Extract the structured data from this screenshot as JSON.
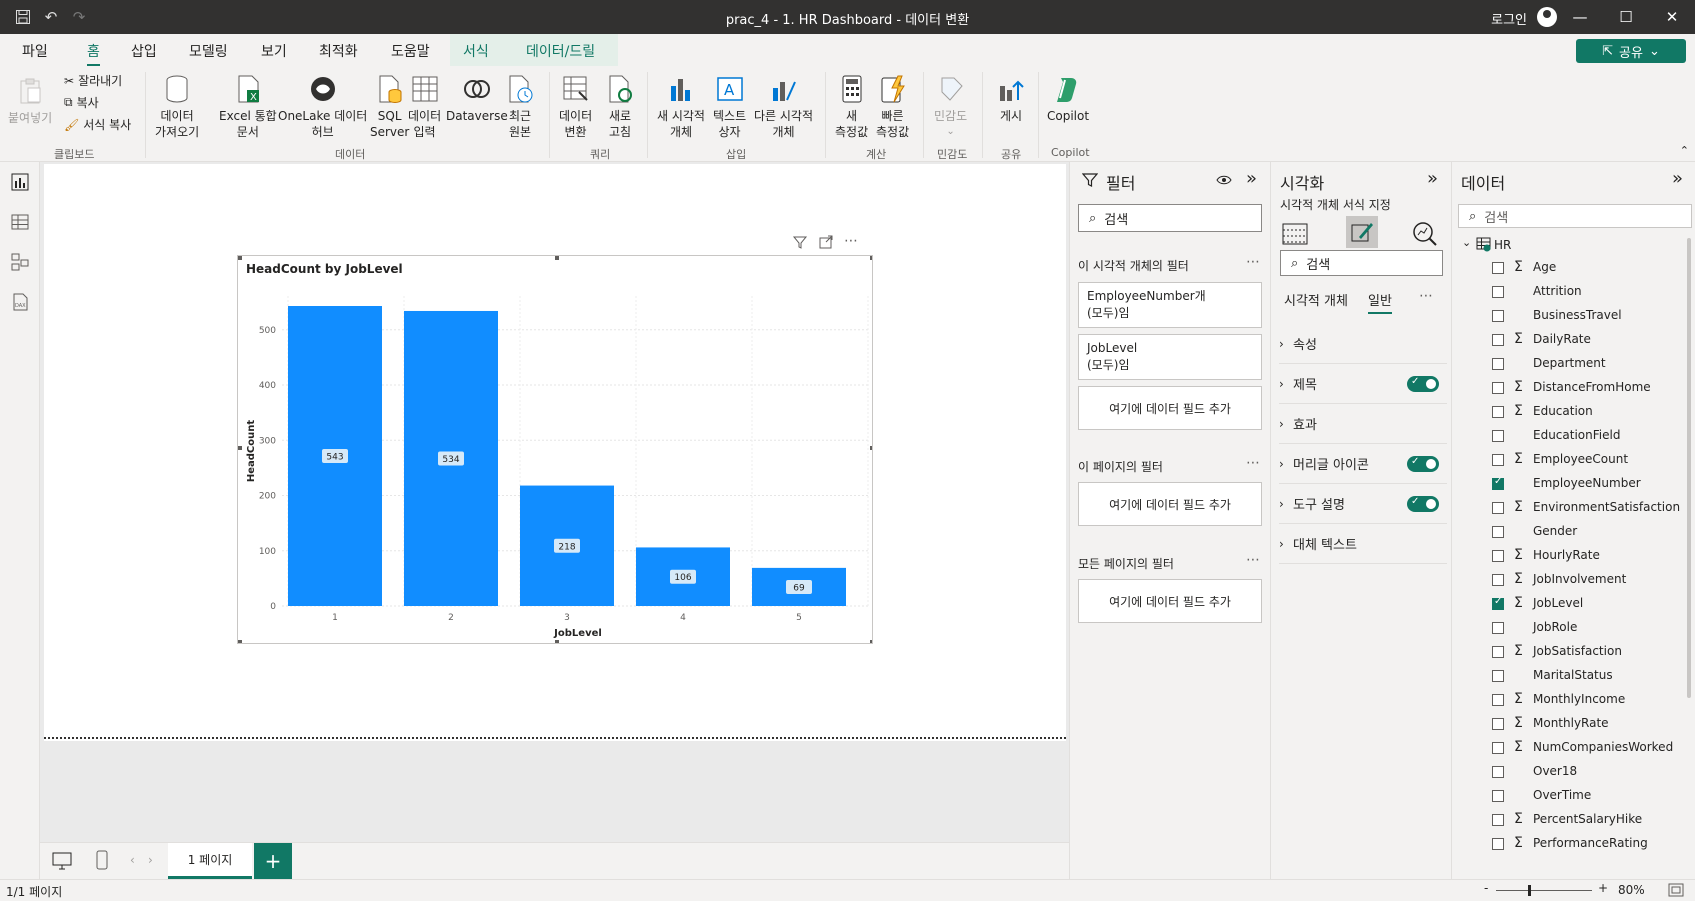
{
  "titlebar": {
    "title": "prac_4 - 1. HR Dashboard - 데이터 변환",
    "login": "로그인"
  },
  "menu": {
    "tabs": [
      "파일",
      "홈",
      "삽입",
      "모델링",
      "보기",
      "최적화",
      "도움말",
      "서식",
      "데이터/드릴"
    ],
    "active": "홈",
    "share": "공유"
  },
  "ribbon": {
    "paste": "붙여넣기",
    "cut": "잘라내기",
    "copy": "복사",
    "format_copy": "서식 복사",
    "clipboard": "클립보드",
    "get_data_1": "데이터",
    "get_data_2": "가져오기",
    "excel_1": "Excel 통합",
    "excel_2": "문서",
    "onelake_1": "OneLake 데이터",
    "onelake_2": "허브",
    "sql_1": "SQL",
    "sql_2": "Server",
    "enter_1": "데이터",
    "enter_2": "입력",
    "dataverse": "Dataverse",
    "recent_1": "최근",
    "recent_2": "원본",
    "data_group": "데이터",
    "transform_1": "데이터",
    "transform_2": "변환",
    "refresh_1": "새로",
    "refresh_2": "고침",
    "query_group": "쿼리",
    "newvisual_1": "새 시각적",
    "newvisual_2": "개체",
    "textbox_1": "텍스트",
    "textbox_2": "상자",
    "othervisual_1": "다른 시각적",
    "othervisual_2": "개체",
    "insert_group": "삽입",
    "newmeasure_1": "새",
    "newmeasure_2": "측정값",
    "quickmeasure_1": "빠른",
    "quickmeasure_2": "측정값",
    "calc_group": "계산",
    "sensitivity": "민감도",
    "sens_group": "민감도",
    "publish": "게시",
    "share_group": "공유",
    "copilot": "Copilot",
    "copilot_group": "Copilot"
  },
  "chart_data": {
    "type": "bar",
    "title": "HeadCount by JobLevel",
    "xlabel": "JobLevel",
    "ylabel": "HeadCount",
    "categories": [
      "1",
      "2",
      "3",
      "4",
      "5"
    ],
    "values": [
      543,
      534,
      218,
      106,
      69
    ],
    "yticks": [
      "0",
      "100",
      "200",
      "300",
      "400",
      "500"
    ],
    "ylim": [
      0,
      543
    ],
    "grid": true,
    "bar_color": "#118DFF"
  },
  "filters": {
    "title": "필터",
    "search": "검색",
    "visual_section": "이 시각적 개체의 필터",
    "card1_line1": "EmployeeNumber개",
    "card1_line2": "(모두)임",
    "card2_line1": "JobLevel",
    "card2_line2": "(모두)임",
    "add_field": "여기에 데이터 필드 추가",
    "page_section": "이 페이지의 필터",
    "all_section": "모든 페이지의 필터"
  },
  "viz": {
    "title": "시각화",
    "subtitle": "시각적 개체 서식 지정",
    "search": "검색",
    "tab_visual": "시각적 개체",
    "tab_general": "일반",
    "rows": [
      "속성",
      "제목",
      "효과",
      "머리글 아이콘",
      "도구 설명",
      "대체 텍스트"
    ]
  },
  "data": {
    "title": "데이터",
    "search": "검색",
    "table": "HR",
    "fields": [
      {
        "name": "Age",
        "sigma": true,
        "checked": false
      },
      {
        "name": "Attrition",
        "sigma": false,
        "checked": false
      },
      {
        "name": "BusinessTravel",
        "sigma": false,
        "checked": false
      },
      {
        "name": "DailyRate",
        "sigma": true,
        "checked": false
      },
      {
        "name": "Department",
        "sigma": false,
        "checked": false
      },
      {
        "name": "DistanceFromHome",
        "sigma": true,
        "checked": false
      },
      {
        "name": "Education",
        "sigma": true,
        "checked": false
      },
      {
        "name": "EducationField",
        "sigma": false,
        "checked": false
      },
      {
        "name": "EmployeeCount",
        "sigma": true,
        "checked": false
      },
      {
        "name": "EmployeeNumber",
        "sigma": false,
        "checked": true
      },
      {
        "name": "EnvironmentSatisfaction",
        "sigma": true,
        "checked": false
      },
      {
        "name": "Gender",
        "sigma": false,
        "checked": false
      },
      {
        "name": "HourlyRate",
        "sigma": true,
        "checked": false
      },
      {
        "name": "JobInvolvement",
        "sigma": true,
        "checked": false
      },
      {
        "name": "JobLevel",
        "sigma": true,
        "checked": true
      },
      {
        "name": "JobRole",
        "sigma": false,
        "checked": false
      },
      {
        "name": "JobSatisfaction",
        "sigma": true,
        "checked": false
      },
      {
        "name": "MaritalStatus",
        "sigma": false,
        "checked": false
      },
      {
        "name": "MonthlyIncome",
        "sigma": true,
        "checked": false
      },
      {
        "name": "MonthlyRate",
        "sigma": true,
        "checked": false
      },
      {
        "name": "NumCompaniesWorked",
        "sigma": true,
        "checked": false
      },
      {
        "name": "Over18",
        "sigma": false,
        "checked": false
      },
      {
        "name": "OverTime",
        "sigma": false,
        "checked": false
      },
      {
        "name": "PercentSalaryHike",
        "sigma": true,
        "checked": false
      },
      {
        "name": "PerformanceRating",
        "sigma": true,
        "checked": false
      }
    ]
  },
  "pages": {
    "tab": "1 페이지"
  },
  "status": {
    "page": "1/1 페이지",
    "zoom": "80%"
  }
}
